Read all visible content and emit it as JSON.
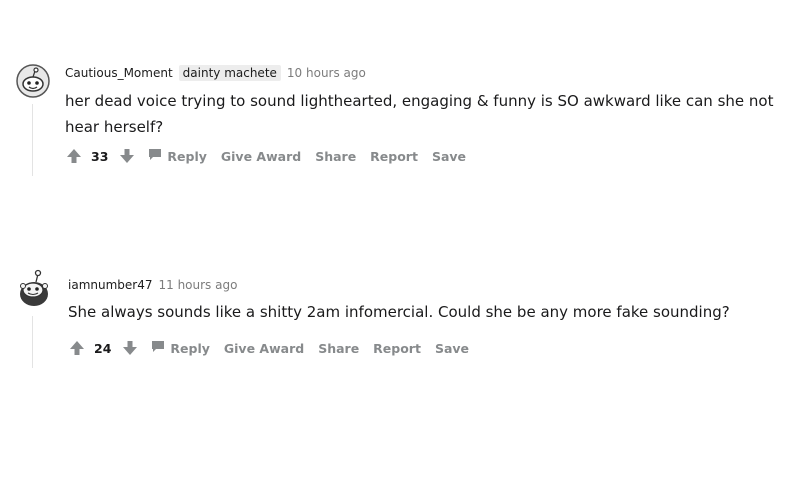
{
  "comments": [
    {
      "username": "Cautious_Moment",
      "flair": "dainty machete",
      "time": "10 hours ago",
      "text": "her dead voice trying to sound lighthearted, engaging & funny is SO awkward like can she not hear herself?",
      "score": "33",
      "actions": {
        "reply": "Reply",
        "give_award": "Give Award",
        "share": "Share",
        "report": "Report",
        "save": "Save"
      }
    },
    {
      "username": "iamnumber47",
      "time": "11 hours ago",
      "text": "She always sounds like a shitty 2am infomercial. Could she be any more fake sounding?",
      "score": "24",
      "actions": {
        "reply": "Reply",
        "give_award": "Give Award",
        "share": "Share",
        "report": "Report",
        "save": "Save"
      }
    }
  ],
  "colors": {
    "action_gray": "#878a8c",
    "meta_gray": "#7c7c7c",
    "text": "#1a1a1b",
    "flair_bg": "#ededed"
  },
  "icons": [
    "snoo-avatar-icon",
    "upvote-arrow-icon",
    "downvote-arrow-icon",
    "comment-bubble-icon"
  ]
}
